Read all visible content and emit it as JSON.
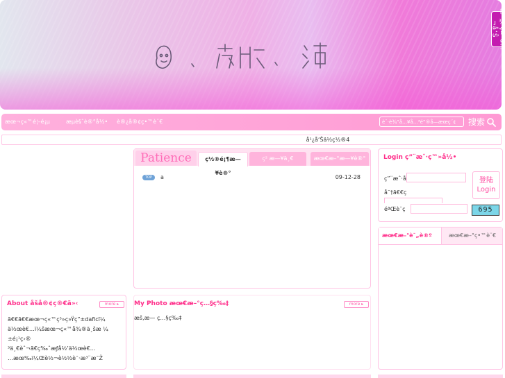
{
  "banner": {
    "notice_label": "æ˜¾ç¤ºå…¬å‘Š"
  },
  "nav": {
    "items": [
      {
        "label": "æœ¬ç«™é¦–é¡µ"
      },
      {
        "label": "æµè§ˆè®°å½•"
      },
      {
        "label": "è®¿å®¢ç•™è¨€"
      }
    ],
    "search_placeholder": "è¯·è¾“å…¥å…³é”®å—æœç´¢",
    "search_label": "搜索"
  },
  "announcement": "å¹¿å‘Šä½ç½®4",
  "article_panel": {
    "logo_text": "Patience",
    "tabs": [
      {
        "label": "ç½®é¡¶æ—¥è®°"
      },
      {
        "label": "ç² æ—¥ä¸€"
      },
      {
        "label": "æœ€æ–°æ—¥è®°"
      }
    ],
    "top_badge": "TOP",
    "posts": [
      {
        "title": "a",
        "date": "09-12-28"
      }
    ]
  },
  "login_panel": {
    "title": "Login ç”¨æˆ·ç™»å½•",
    "username_label": "ç”¨æˆ·å",
    "password_label": "å¯†ã€€ç ",
    "captcha_label": "éªŒè¯ç ",
    "login_button_line1": "登陆",
    "login_button_line2": "Login",
    "captcha_text": "695"
  },
  "visitor_panel": {
    "tabs": [
      {
        "label": "æœ€æ–°è¯„è®º"
      },
      {
        "label": "æœ€æ–°ç•™è¨€"
      }
    ]
  },
  "about_panel": {
    "title": "About åšå®¢ç®€ä»‹",
    "more": "more",
    "lines": [
      "ã€€ã€€æœ¬ç«™ç³»ç»Ÿç”±daficï¼",
      "ä½œè€…ï¼šæœ¬ç«™å¾®ä¸šæ ¼",
      "±é¡¹ç›®",
      "³ä¸€èˆ¬ã€ç‰ˆæƒå½’ä½œè€…",
      "…æœ‰ï¼Œè½¬è½½è¯·æ³¨æ˜Ž"
    ]
  },
  "photo_panel": {
    "title": "My Photo æœ€æ–°ç…§ç‰‡",
    "more": "more",
    "text": "æš‚æ— ç…§ç‰‡"
  }
}
